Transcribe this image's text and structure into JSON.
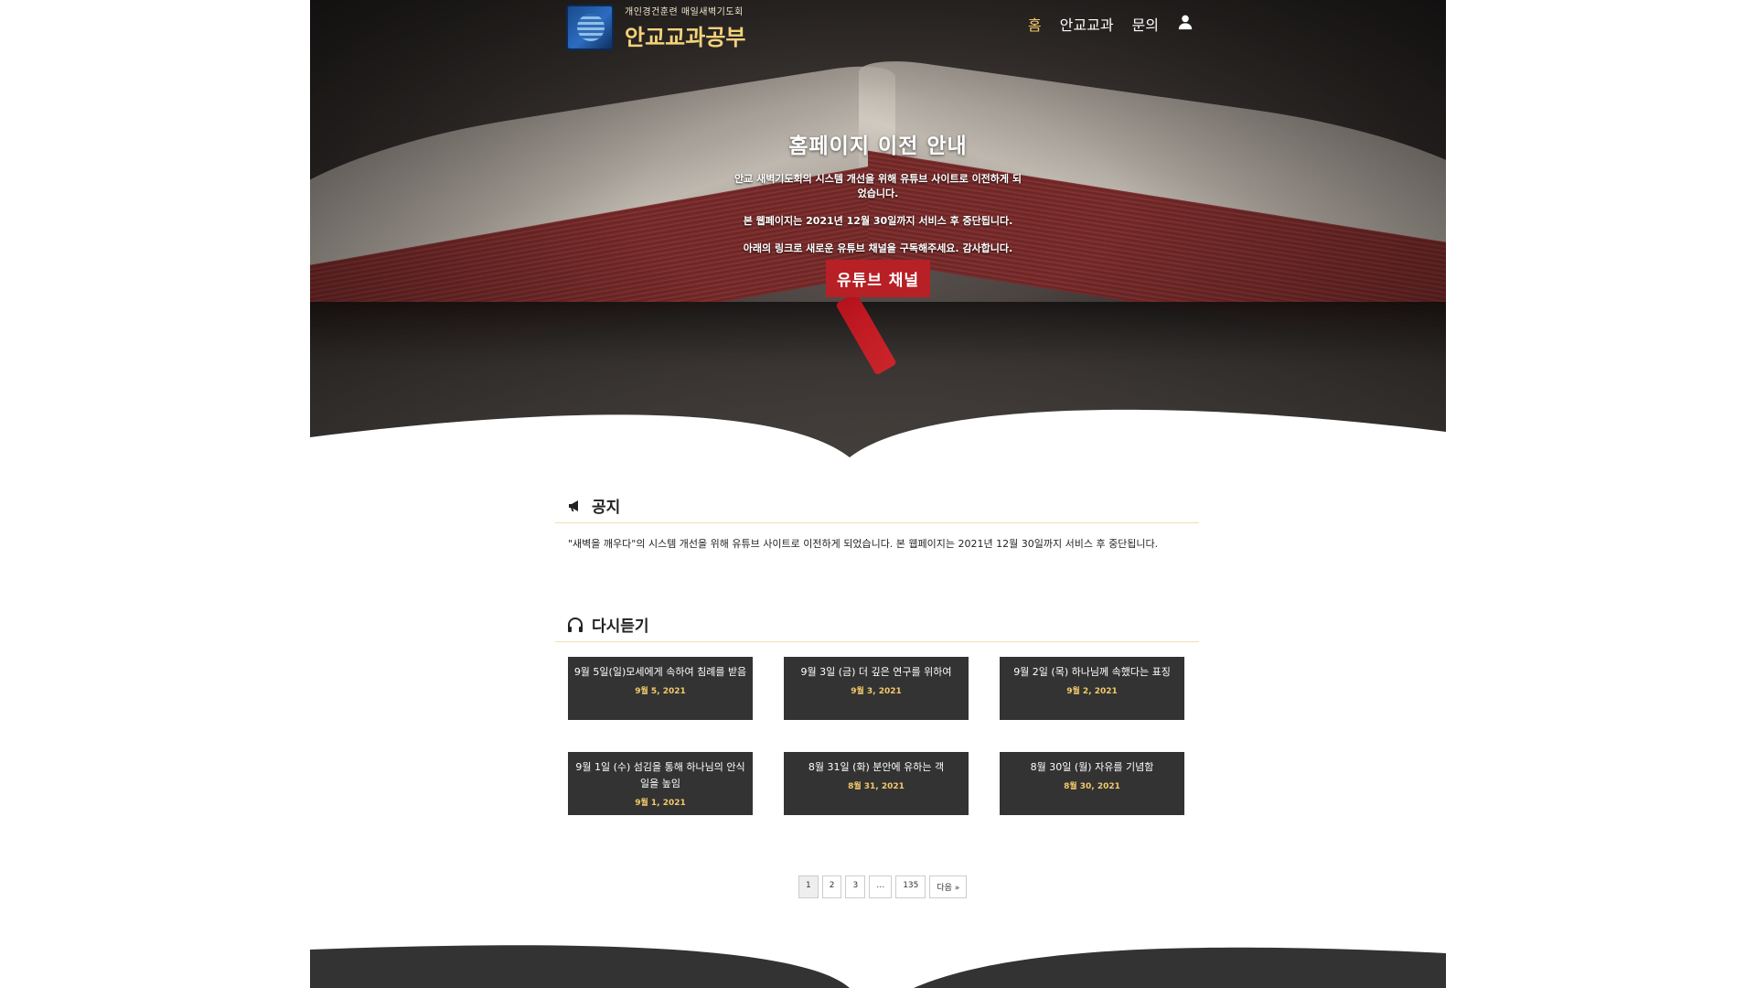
{
  "header": {
    "logo_small": "개인경건훈련 매일새벽기도회",
    "logo_big": "안교교과공부",
    "nav": [
      {
        "label": "홈",
        "active": true
      },
      {
        "label": "안교교과",
        "active": false
      },
      {
        "label": "문의",
        "active": false
      }
    ],
    "user_icon": "user-icon"
  },
  "hero": {
    "title": "홈페이지 이전 안내",
    "p1": "안교 새벽기도회의 시스템 개선을 위해 유튜브 사이트로 이전하게 되었습니다.",
    "p2": "본 웹페이지는 2021년 12월 30일까지 서비스 후 중단됩니다.",
    "p3": "아래의 링크로 새로운 유튜브 채널을 구독해주세요. 감사합니다.",
    "button": "유튜브 채널"
  },
  "notice": {
    "title": "공지",
    "icon": "megaphone-icon",
    "text": "\"새벽을 깨우다\"의 시스템 개선을 위해 유튜브 사이트로 이전하게 되었습니다. 본 웹페이지는 2021년 12월 30일까지 서비스 후 중단됩니다."
  },
  "replay": {
    "title": "다시듣기",
    "icon": "headphones-icon",
    "items": [
      {
        "title": "9월 5일(일)모세에게 속하여 침례를 받음",
        "date": "9월 5, 2021"
      },
      {
        "title": "9월 3일 (금) 더 깊은 연구를 위하여",
        "date": "9월 3, 2021"
      },
      {
        "title": "9월 2일 (목) 하나님께 속했다는 표징",
        "date": "9월 2, 2021"
      },
      {
        "title": "9월 1일 (수) 섬김을 통해 하나님의 안식일을 높임",
        "date": "9월 1, 2021"
      },
      {
        "title": "8월 31일 (화) 분안에 유하는 객",
        "date": "8월 31, 2021"
      },
      {
        "title": "8월 30일 (월) 자유를 기념함",
        "date": "8월 30, 2021"
      }
    ]
  },
  "pagination": {
    "pages": [
      "1",
      "2",
      "3",
      "…",
      "135"
    ],
    "next": "다음 »",
    "current": "1"
  }
}
